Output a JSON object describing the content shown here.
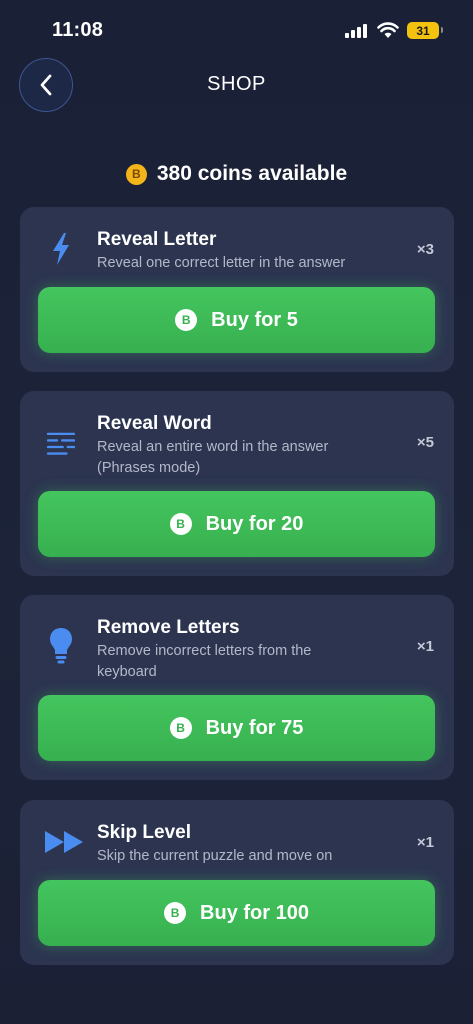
{
  "status_bar": {
    "time": "11:08",
    "battery": "31"
  },
  "header": {
    "title": "SHOP",
    "back_icon": "chevron-left-icon"
  },
  "coins": {
    "icon_letter": "B",
    "text": "380 coins available"
  },
  "colors": {
    "background": "#1c2237",
    "card": "#2c3450",
    "button_green": "#3dbb56",
    "accent_blue": "#4a8cf0",
    "coin_gold": "#f3b51a",
    "battery_yellow": "#f2c20e"
  },
  "items": [
    {
      "icon": "lightning-bolt-icon",
      "title": "Reveal Letter",
      "description": "Reveal one correct letter in the answer",
      "quantity": "×3",
      "button_label": "Buy for 5",
      "coin_letter": "B"
    },
    {
      "icon": "lines-icon",
      "title": "Reveal Word",
      "description": "Reveal an entire word in the answer (Phrases mode)",
      "quantity": "×5",
      "button_label": "Buy for 20",
      "coin_letter": "B"
    },
    {
      "icon": "lightbulb-icon",
      "title": "Remove Letters",
      "description": "Remove incorrect letters from the keyboard",
      "quantity": "×1",
      "button_label": "Buy for 75",
      "coin_letter": "B"
    },
    {
      "icon": "fast-forward-icon",
      "title": "Skip Level",
      "description": "Skip the current puzzle and move on",
      "quantity": "×1",
      "button_label": "Buy for 100",
      "coin_letter": "B"
    }
  ]
}
